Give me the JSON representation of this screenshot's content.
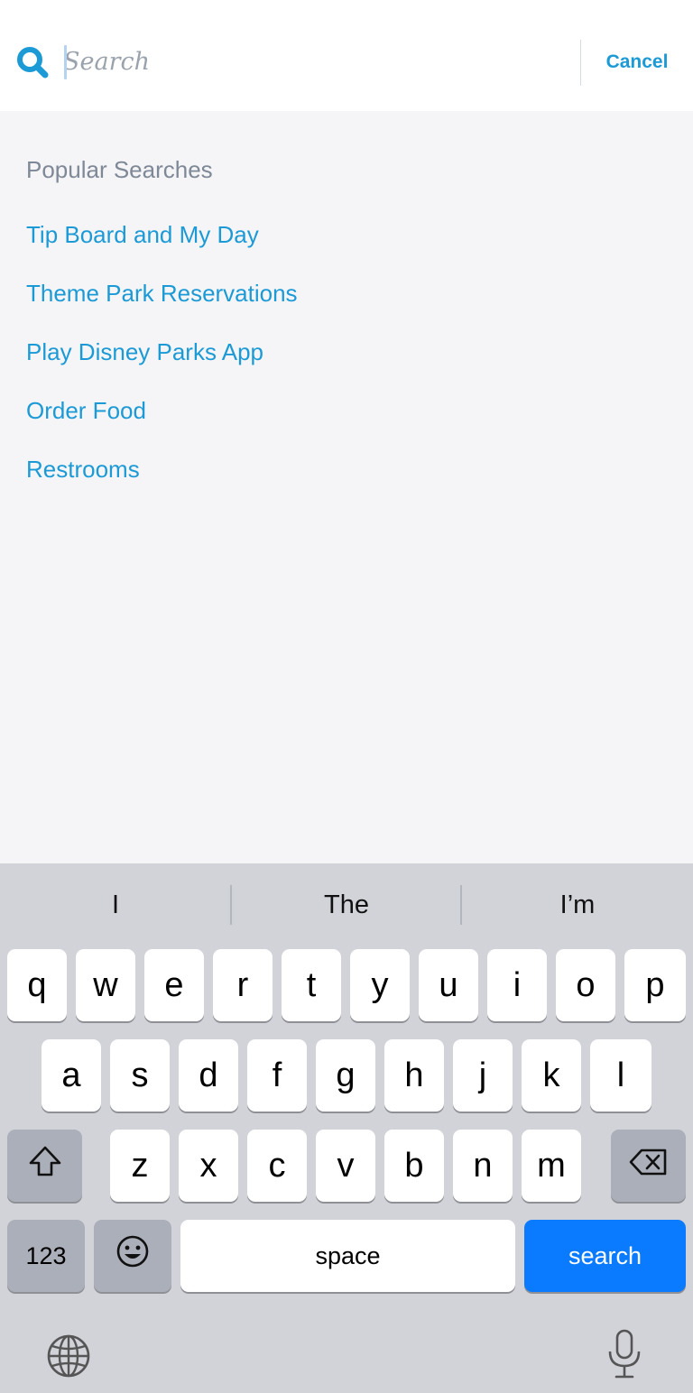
{
  "search": {
    "placeholder": "Search",
    "value": "",
    "cancel_label": "Cancel"
  },
  "popular": {
    "title": "Popular Searches",
    "items": [
      "Tip Board and My Day",
      "Theme Park Reservations",
      "Play Disney Parks App",
      "Order Food",
      "Restrooms"
    ]
  },
  "keyboard": {
    "suggestions": [
      "I",
      "The",
      "I’m"
    ],
    "row1": [
      "q",
      "w",
      "e",
      "r",
      "t",
      "y",
      "u",
      "i",
      "o",
      "p"
    ],
    "row2": [
      "a",
      "s",
      "d",
      "f",
      "g",
      "h",
      "j",
      "k",
      "l"
    ],
    "row3": [
      "z",
      "x",
      "c",
      "v",
      "b",
      "n",
      "m"
    ],
    "numbers_label": "123",
    "space_label": "space",
    "search_label": "search",
    "icons": {
      "shift": "shift-icon",
      "backspace": "backspace-icon",
      "emoji": "emoji-icon",
      "globe": "globe-icon",
      "microphone": "microphone-icon"
    }
  },
  "colors": {
    "accent": "#1c9ad6",
    "header_bg": "#ffffff",
    "page_bg": "#f5f5f7",
    "keyboard_bg": "#d1d3d9",
    "search_key": "#0a7bff"
  }
}
